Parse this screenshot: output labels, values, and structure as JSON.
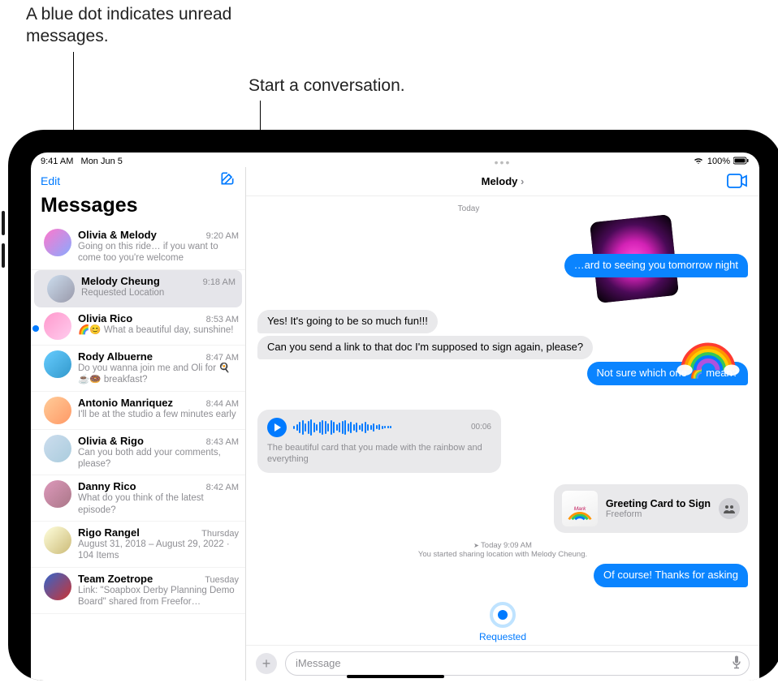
{
  "callouts": {
    "unread": "A blue dot indicates unread messages.",
    "compose": "Start a conversation."
  },
  "status": {
    "time": "9:41 AM",
    "date": "Mon Jun 5",
    "wifi": "wifi-icon",
    "battery": "100%"
  },
  "sidebar": {
    "edit": "Edit",
    "title": "Messages",
    "items": [
      {
        "name": "Olivia & Melody",
        "time": "9:20 AM",
        "preview": "Going on this ride… if you want to come too you're welcome",
        "unread": false
      },
      {
        "name": "Melody Cheung",
        "time": "9:18 AM",
        "preview": "Requested Location",
        "selected": true
      },
      {
        "name": "Olivia Rico",
        "time": "8:53 AM",
        "preview": "🌈😊 What a beautiful day, sunshine!",
        "unread": true
      },
      {
        "name": "Rody Albuerne",
        "time": "8:47 AM",
        "preview": "Do you wanna join me and Oli for 🍳☕🍩 breakfast?"
      },
      {
        "name": "Antonio Manriquez",
        "time": "8:44 AM",
        "preview": "I'll be at the studio a few minutes early"
      },
      {
        "name": "Olivia & Rigo",
        "time": "8:43 AM",
        "preview": "Can you both add your comments, please?"
      },
      {
        "name": "Danny Rico",
        "time": "8:42 AM",
        "preview": "What do you think of the latest episode?"
      },
      {
        "name": "Rigo Rangel",
        "time": "Thursday",
        "preview": "August 31, 2018 – August 29, 2022 · 104 Items"
      },
      {
        "name": "Team Zoetrope",
        "time": "Tuesday",
        "preview": "Link: \"Soapbox Derby Planning Demo Board\" shared from Freefor…"
      }
    ]
  },
  "chat": {
    "contact": "Melody",
    "day_label": "Today",
    "messages": {
      "m1_sent": "…ard to seeing you tomorrow night",
      "m2_recv": "Yes! It's going to be so much fun!!!",
      "m3_recv": "Can you send a link to that doc I'm supposed to sign again, please?",
      "m4_sent": "Not sure which one 🌈 mean?",
      "audio_duration": "00:06",
      "audio_caption": "The beautiful card that you made with the rainbow and everything",
      "attach_title": "Greeting Card to Sign",
      "attach_sub": "Freeform",
      "system_time": "Today 9:09 AM",
      "system_note": "You started sharing location with Melody Cheung.",
      "m5_sent": "Of course! Thanks for asking",
      "requested": "Requested"
    },
    "compose_placeholder": "iMessage"
  },
  "colors": {
    "accent": "#007aff",
    "sent_bubble": "#0a84ff",
    "recv_bubble": "#e9e9eb",
    "secondary_text": "#8e8e93"
  }
}
